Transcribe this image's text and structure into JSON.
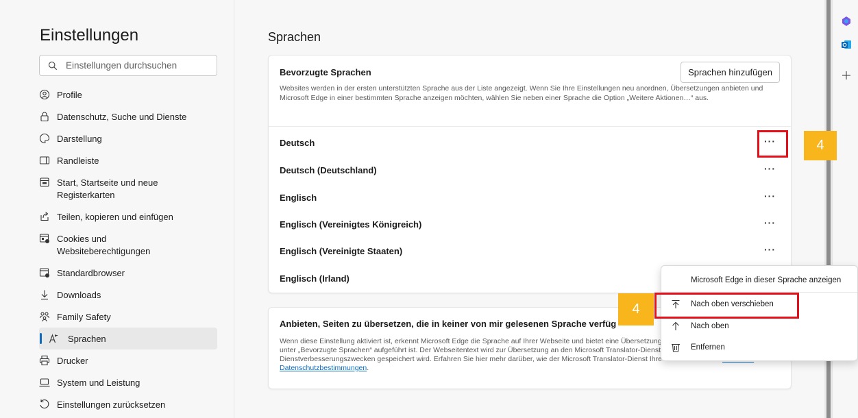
{
  "sidebar": {
    "title": "Einstellungen",
    "search_placeholder": "Einstellungen durchsuchen",
    "items": [
      {
        "label": "Profile",
        "icon": "profile-icon"
      },
      {
        "label": "Datenschutz, Suche und Dienste",
        "icon": "lock-icon"
      },
      {
        "label": "Darstellung",
        "icon": "appearance-icon"
      },
      {
        "label": "Randleiste",
        "icon": "sidebar-icon"
      },
      {
        "label": "Start, Startseite und neue Registerkarten",
        "icon": "home-tab-icon"
      },
      {
        "label": "Teilen, kopieren und einfügen",
        "icon": "share-icon"
      },
      {
        "label": "Cookies und Websiteberechtigungen",
        "icon": "cookie-icon"
      },
      {
        "label": "Standardbrowser",
        "icon": "default-browser-icon"
      },
      {
        "label": "Downloads",
        "icon": "download-icon"
      },
      {
        "label": "Family Safety",
        "icon": "family-icon"
      },
      {
        "label": "Sprachen",
        "icon": "language-icon",
        "active": true
      },
      {
        "label": "Drucker",
        "icon": "printer-icon"
      },
      {
        "label": "System und Leistung",
        "icon": "laptop-icon"
      },
      {
        "label": "Einstellungen zurücksetzen",
        "icon": "reset-icon"
      }
    ]
  },
  "main": {
    "title": "Sprachen",
    "preferred": {
      "heading": "Bevorzugte Sprachen",
      "add_button": "Sprachen hinzufügen",
      "description": "Websites werden in der ersten unterstützten Sprache aus der Liste angezeigt. Wenn Sie Ihre Einstellungen neu anordnen, Übersetzungen anbieten und Microsoft Edge in einer bestimmten Sprache anzeigen möchten, wählen Sie neben einer Sprache die Option „Weitere Aktionen…“ aus.",
      "languages": [
        "Deutsch",
        "Deutsch (Deutschland)",
        "Englisch",
        "Englisch (Vereinigtes Königreich)",
        "Englisch (Vereinigte Staaten)",
        "Englisch (Irland)"
      ],
      "more_label": "···"
    },
    "translate": {
      "heading": "Anbieten, Seiten zu übersetzen, die in keiner von mir gelesenen Sprache verfüg",
      "description": "Wenn diese Einstellung aktiviert ist, erkennt Microsoft Edge die Sprache auf Ihrer Webseite und bietet eine Übersetzung an. Ist die erkannte Sprache nicht unter „Bevorzugte Sprachen“ aufgeführt ist. Der Webseitentext wird zur Übersetzung an den Microsoft Translator-Dienst gesendet, wo der Text zu Dienstverbesserungszwecken gespeichert wird. Erfahren Sie hier mehr darüber, wie der Microsoft Translator-Dienst Ihre Daten verwendet: ",
      "link": "Microsoft-Datenschutzbestimmungen",
      "link_suffix": "."
    }
  },
  "context_menu": {
    "items": [
      {
        "label": "Microsoft Edge in dieser Sprache anzeigen"
      },
      {
        "label": "Nach oben verschieben",
        "icon": "move-to-top-icon"
      },
      {
        "label": "Nach oben",
        "icon": "arrow-up-icon"
      },
      {
        "label": "Entfernen",
        "icon": "trash-icon"
      }
    ]
  },
  "callouts": {
    "badge1": "4",
    "badge2": "4",
    "highlight_color": "#e3101a",
    "badge_color": "#f9b61c"
  },
  "rail": {
    "icons": [
      "copilot-icon",
      "outlook-icon",
      "plus-icon"
    ]
  },
  "colors": {
    "accent": "#0f6cbd",
    "background": "#f7f7f7",
    "card": "#ffffff"
  }
}
